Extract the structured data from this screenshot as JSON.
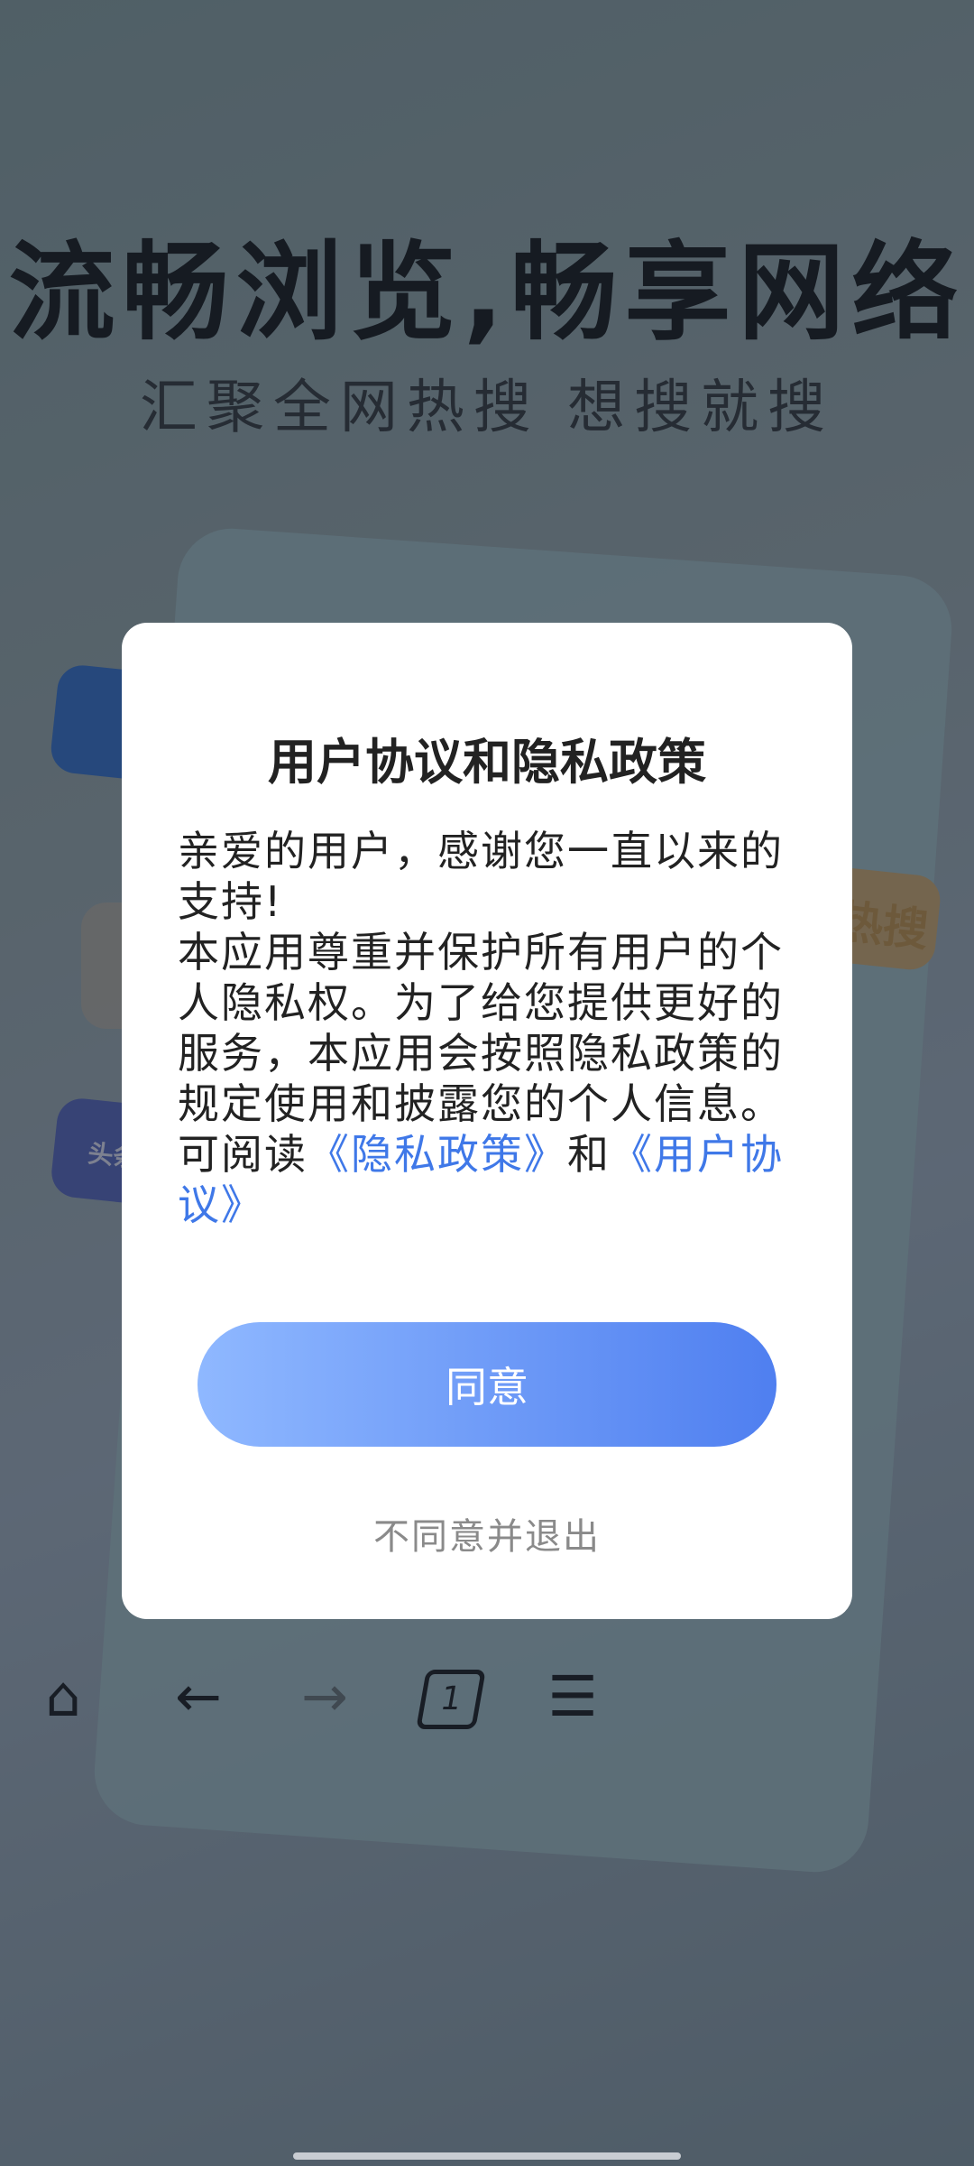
{
  "background": {
    "title": "流畅浏览,畅享网络",
    "subtitle": "汇聚全网热搜 想搜就搜",
    "hot_badge": "热搜",
    "toutiao_badge": "头条",
    "tabs_count": "1"
  },
  "dialog": {
    "title": "用户协议和隐私政策",
    "body_line1": "亲爱的用户，感谢您一直以来的支持!",
    "body_line2": " 本应用尊重并保护所有用户的个人隐私权。为了给您提供更好的服务，本应用会按照隐私政策的规定使用和披露您的个人信息。",
    "read_prefix": "可阅读",
    "privacy_link": "《隐私政策》",
    "and_text": "和",
    "agreement_link": "《用户协议》",
    "agree_label": "同意",
    "disagree_label": "不同意并退出"
  },
  "colors": {
    "link": "#3f78e8",
    "button_gradient_start": "#8fb8ff",
    "button_gradient_end": "#4f7ff0"
  }
}
